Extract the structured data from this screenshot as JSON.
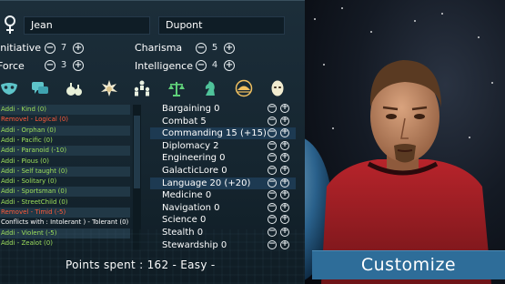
{
  "identity": {
    "first_name": "Jean",
    "last_name": "Dupont"
  },
  "stats": [
    {
      "label": "Initiative",
      "value": "7"
    },
    {
      "label": "Force",
      "value": "3"
    },
    {
      "label": "Charisma",
      "value": "5"
    },
    {
      "label": "Intelligence",
      "value": "4"
    }
  ],
  "category_icons": [
    "mask-icon",
    "speech-icon",
    "potion-icon",
    "explosion-icon",
    "people-icon",
    "scales-icon",
    "chess-knight-icon",
    "sun-emblem-icon",
    "alien-face-icon"
  ],
  "traits": [
    {
      "text": "Addi - Kind (0)",
      "color": "#9ee05a"
    },
    {
      "text": "Removel - Logical (0)",
      "color": "#ff5a3a"
    },
    {
      "text": "Addi - Orphan (0)",
      "color": "#9ee05a"
    },
    {
      "text": "Addi - Pacific (0)",
      "color": "#9ee05a"
    },
    {
      "text": "Addi - Paranoid (-10)",
      "color": "#9ee05a"
    },
    {
      "text": "Addi - Pious (0)",
      "color": "#9ee05a"
    },
    {
      "text": "Addi - Self taught (0)",
      "color": "#9ee05a"
    },
    {
      "text": "Addi - Solitary (0)",
      "color": "#9ee05a"
    },
    {
      "text": "Addi - Sportsman (0)",
      "color": "#9ee05a"
    },
    {
      "text": "Addi - StreetChild (0)",
      "color": "#9ee05a"
    },
    {
      "text": "Removel - Timid (-5)",
      "color": "#ff5a3a"
    },
    {
      "text": "Conflicts with : Intolerant ) - Tolerant (0)",
      "color": "#ffffff"
    },
    {
      "text": "Addi - Violent (-5)",
      "color": "#9ee05a"
    },
    {
      "text": "Addi - Zealot (0)",
      "color": "#9ee05a"
    }
  ],
  "skills": [
    {
      "name": "Bargaining 0",
      "highlight": false
    },
    {
      "name": "Combat 5",
      "highlight": false
    },
    {
      "name": "Commanding 15 (+15)",
      "highlight": true
    },
    {
      "name": "Diplomacy 2",
      "highlight": false
    },
    {
      "name": "Engineering 0",
      "highlight": false
    },
    {
      "name": "GalacticLore 0",
      "highlight": false
    },
    {
      "name": "Language 20 (+20)",
      "highlight": true
    },
    {
      "name": "Medicine 0",
      "highlight": false
    },
    {
      "name": "Navigation 0",
      "highlight": false
    },
    {
      "name": "Science 0",
      "highlight": false
    },
    {
      "name": "Stealth 0",
      "highlight": false
    },
    {
      "name": "Stewardship 0",
      "highlight": false
    }
  ],
  "footer": {
    "points_text": "Points spent : 162 - Easy -"
  },
  "actions": {
    "customize_label": "Customize"
  },
  "colors": {
    "panel_bg": "#1c2e3a",
    "accent_button": "#2e6d99",
    "add_trait": "#9ee05a",
    "remove_trait": "#ff5a3a"
  }
}
